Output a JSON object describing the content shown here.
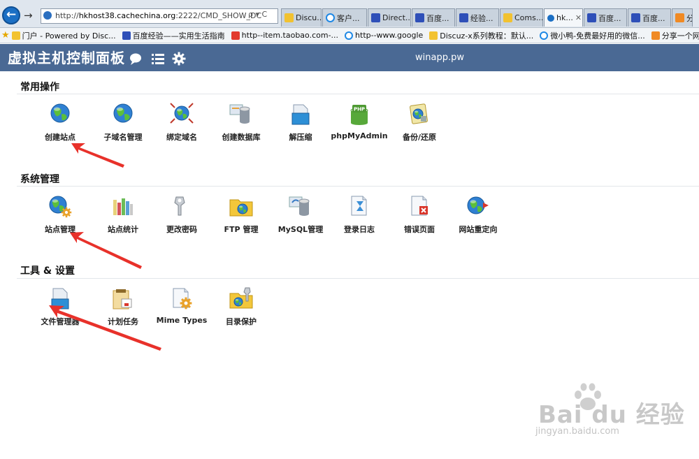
{
  "browser": {
    "address_prefix": "http://",
    "address_host": "hkhost38.cachechina.org",
    "address_rest": ":2222/CMD_SHOW_DC",
    "address_tools": "ρ ▾ C",
    "tabs": [
      {
        "label": "Discu...",
        "icon": "folder-icon"
      },
      {
        "label": "客户...",
        "icon": "ie-icon"
      },
      {
        "label": "Direct...",
        "icon": "paw-icon"
      },
      {
        "label": "百度...",
        "icon": "paw-icon"
      },
      {
        "label": "经验...",
        "icon": "paw-icon"
      },
      {
        "label": "Coms...",
        "icon": "folder-icon"
      },
      {
        "label": "hk...",
        "icon": "globe-icon",
        "close": "✕"
      },
      {
        "label": "百度...",
        "icon": "paw-icon"
      },
      {
        "label": "百度...",
        "icon": "paw-icon"
      },
      {
        "label": "分...",
        "icon": "gift-icon"
      }
    ],
    "bookmarks": [
      {
        "label": "门户 - Powered by Disc...",
        "icon": "folder-icon"
      },
      {
        "label": "百度经验——实用生活指南",
        "icon": "paw-icon"
      },
      {
        "label": "http--item.taobao.com-...",
        "icon": "taobao-icon"
      },
      {
        "label": "http--www.google",
        "icon": "ie-icon"
      },
      {
        "label": "Discuz-x系列教程：默认...",
        "icon": "folder-icon"
      },
      {
        "label": "微小鸭-免费最好用的微信...",
        "icon": "ie-icon"
      },
      {
        "label": "分享一个网友购买",
        "icon": "gift-icon"
      }
    ]
  },
  "header": {
    "title": "虚拟主机控制面板",
    "domain": "winapp.pw",
    "bg_color": "#4a6994"
  },
  "sections": [
    {
      "title": "常用操作",
      "items": [
        {
          "label": "创建站点",
          "icon": "globe-icon"
        },
        {
          "label": "子域名管理",
          "icon": "globe-icon"
        },
        {
          "label": "绑定域名",
          "icon": "globe-network-icon"
        },
        {
          "label": "创建数据库",
          "icon": "database-icon"
        },
        {
          "label": "解压缩",
          "icon": "archive-icon"
        },
        {
          "label": "phpMyAdmin",
          "icon": "php-database-icon"
        },
        {
          "label": "备份/还原",
          "icon": "backup-icon"
        }
      ]
    },
    {
      "title": "系统管理",
      "items": [
        {
          "label": "站点管理",
          "icon": "globe-gear-icon"
        },
        {
          "label": "站点统计",
          "icon": "bar-chart-icon"
        },
        {
          "label": "更改密码",
          "icon": "key-icon"
        },
        {
          "label": "FTP 管理",
          "icon": "folder-globe-icon"
        },
        {
          "label": "MySQL管理",
          "icon": "mysql-icon"
        },
        {
          "label": "登录日志",
          "icon": "hourglass-doc-icon"
        },
        {
          "label": "错误页面",
          "icon": "error-page-icon"
        },
        {
          "label": "网站重定向",
          "icon": "redirect-globe-icon"
        }
      ]
    },
    {
      "title": "工具 & 设置",
      "items": [
        {
          "label": "文件管理器",
          "icon": "file-manager-icon"
        },
        {
          "label": "计划任务",
          "icon": "calendar-icon"
        },
        {
          "label": "Mime Types",
          "icon": "mime-gear-icon"
        },
        {
          "label": "目录保护",
          "icon": "folder-key-icon"
        }
      ]
    }
  ],
  "annotation_color": "#e8312a",
  "watermark": {
    "logo": "Bai du 经验",
    "url": "jingyan.baidu.com"
  }
}
